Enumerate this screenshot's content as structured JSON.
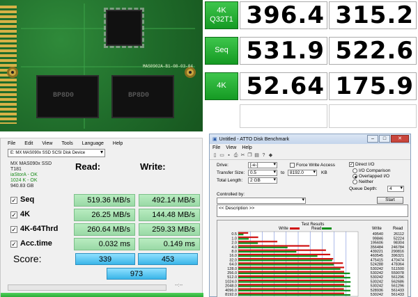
{
  "pcb_photo": {
    "chip_labels": [
      "BP8D0",
      "BP8D0"
    ],
    "board_label": "MAS0902A-B1-08-03-04"
  },
  "big_table": {
    "rows": [
      {
        "label_line1": "4K",
        "label_line2": "Q32T1",
        "read": "396.4",
        "write": "315.2"
      },
      {
        "label_line1": "Seq",
        "label_line2": "",
        "read": "531.9",
        "write": "522.6"
      },
      {
        "label_line1": "4K",
        "label_line2": "",
        "read": "52.64",
        "write": "175.9"
      }
    ]
  },
  "as_ssd": {
    "menu": [
      "File",
      "Edit",
      "View",
      "Tools",
      "Language",
      "Help"
    ],
    "drive": "E: MX MAS090x SSD SCSI Disk Device",
    "info": {
      "model": "MX MAS090x SSD",
      "firmware": "T181",
      "driver": "iaStorA - OK",
      "alignment": "1024 K - OK",
      "size": "940.83 GB"
    },
    "read_header": "Read:",
    "write_header": "Write:",
    "rows": [
      {
        "label": "Seq",
        "read": "519.36 MB/s",
        "write": "492.14 MB/s"
      },
      {
        "label": "4K",
        "read": "26.25 MB/s",
        "write": "144.48 MB/s"
      },
      {
        "label": "4K-64Thrd",
        "read": "260.64 MB/s",
        "write": "259.33 MB/s"
      },
      {
        "label": "Acc.time",
        "read": "0.032 ms",
        "write": "0.149 ms"
      }
    ],
    "score_label": "Score:",
    "score_read": "339",
    "score_write": "453",
    "score_total": "973",
    "time": "--:--"
  },
  "atto": {
    "title": "Untitled - ATTO Disk Benchmark",
    "menu": [
      "File",
      "View",
      "Help"
    ],
    "toolbar_icons": [
      "new-icon",
      "open-icon",
      "save-icon",
      "print-icon",
      "cut-icon",
      "copy-icon",
      "paste-icon",
      "help-icon",
      "about-icon"
    ],
    "drive_label": "Drive:",
    "drive_value": "[-e-]",
    "force_write_label": "Force Write Access",
    "transfer_size_label": "Transfer Size:",
    "transfer_from": "0.5",
    "transfer_to_label": "to",
    "transfer_to": "8192.0",
    "transfer_unit": "KB",
    "total_length_label": "Total Length:",
    "total_length": "2 GB",
    "direct_io_label": "Direct I/O",
    "io_comparison_label": "I/O Comparison",
    "overlapped_io_label": "Overlapped I/O",
    "neither_label": "Neither",
    "queue_depth_label": "Queue Depth:",
    "queue_depth": "4",
    "controlled_by_label": "Controlled by:",
    "start_label": "Start",
    "description": "<< Description >>",
    "results_title": "Test Results",
    "write_legend": "Write",
    "read_legend": "Read",
    "write_color": "#d01010",
    "read_color": "#0a8f1a",
    "col_write": "Write",
    "col_read": "Read"
  },
  "chart_data": {
    "type": "bar",
    "title": "Test Results",
    "categories": [
      "0.5",
      "1.0",
      "2.0",
      "4.0",
      "8.0",
      "16.0",
      "32.0",
      "64.0",
      "128.0",
      "256.0",
      "512.0",
      "1024.0",
      "2048.0",
      "4096.0",
      "8192.0"
    ],
    "series": [
      {
        "name": "Write",
        "values": [
          49540,
          99846,
          195606,
          356484,
          439221,
          460545,
          475415,
          524288,
          530242,
          530242,
          530242,
          530242,
          530242,
          528936,
          530242
        ]
      },
      {
        "name": "Read",
        "values": [
          26112,
          52224,
          98304,
          246784,
          290816,
          396321,
          470474,
          478364,
          511500,
          559078,
          561296,
          562686,
          561296,
          561433,
          561433
        ]
      }
    ],
    "xlim": [
      0,
      600000
    ],
    "legend": "top"
  }
}
